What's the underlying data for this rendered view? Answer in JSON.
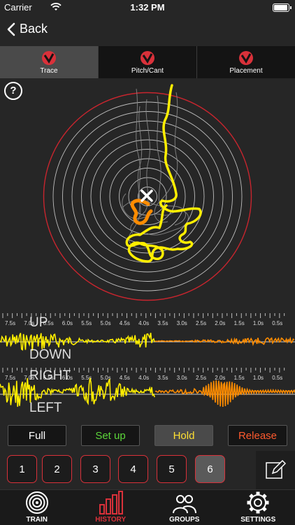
{
  "status": {
    "carrier": "Carrier",
    "time": "1:32 PM"
  },
  "nav": {
    "back_label": "Back"
  },
  "tabs": [
    {
      "label": "Trace",
      "active": true
    },
    {
      "label": "Pitch/Cant",
      "active": false
    },
    {
      "label": "Placement",
      "active": false
    }
  ],
  "help": {
    "label": "?"
  },
  "waves": {
    "top": {
      "label_up": "UP",
      "label_down": "DOWN"
    },
    "bottom": {
      "label_up": "RIGHT",
      "label_down": "LEFT"
    },
    "time_ticks": [
      "7.5s",
      "7.0s",
      "6.5s",
      "6.0s",
      "5.5s",
      "5.0s",
      "4.5s",
      "4.0s",
      "3.5s",
      "3.0s",
      "2.5s",
      "2.0s",
      "1.5s",
      "1.0s",
      "0.5s"
    ]
  },
  "controls": {
    "full": "Full",
    "setup": "Set up",
    "hold": "Hold",
    "release": "Release"
  },
  "shots": [
    "1",
    "2",
    "3",
    "4",
    "5",
    "6"
  ],
  "selected_shot": "6",
  "tabbar": {
    "train": "TRAIN",
    "history": "HISTORY",
    "groups": "GROUPS",
    "settings": "SETTINGS"
  },
  "colors": {
    "accent_red": "#d9313a",
    "trace_yellow": "#ffee00",
    "trace_orange": "#ff8c00",
    "setup_green": "#5cd63a",
    "hold_yellow": "#ffe033",
    "release_orange": "#ff5a2e"
  }
}
